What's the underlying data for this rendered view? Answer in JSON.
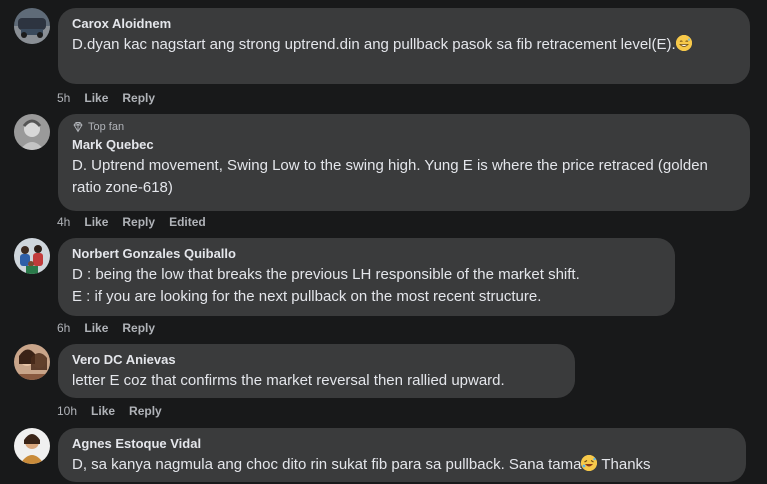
{
  "comments": [
    {
      "author": "Carox Aloidnem",
      "text": "D.dyan kac nagstart ang strong uptrend.din ang pullback pasok sa fib retracement level(E).",
      "emoji": "sweat-smile-emoji",
      "time": "5h",
      "like": "Like",
      "reply": "Reply"
    },
    {
      "badge": "Top fan",
      "author": "Mark Quebec",
      "text": "D. Uptrend movement, Swing Low to the swing high. Yung E is where the price retraced (golden ratio zone-618)",
      "time": "4h",
      "like": "Like",
      "reply": "Reply",
      "edited": "Edited"
    },
    {
      "author": "Norbert Gonzales Quiballo",
      "line1": "D : being the low that breaks the previous LH responsible of the market shift.",
      "line2": "E : if you are looking for the next pullback on the most recent structure.",
      "time": "6h",
      "like": "Like",
      "reply": "Reply"
    },
    {
      "author": "Vero DC Anievas",
      "text": "letter E coz that confirms the market reversal then rallied upward.",
      "time": "10h",
      "like": "Like",
      "reply": "Reply"
    },
    {
      "author": "Agnes Estoque Vidal",
      "text_before": "D, sa kanya nagmula ang choc dito rin sukat fib para sa pullback. Sana tama",
      "emoji": "rofl-emoji",
      "text_after": " Thanks"
    }
  ],
  "colors": {
    "background": "#18191a",
    "bubble": "#3a3b3c",
    "text": "#e4e6eb",
    "secondary": "#b0b3b8"
  }
}
